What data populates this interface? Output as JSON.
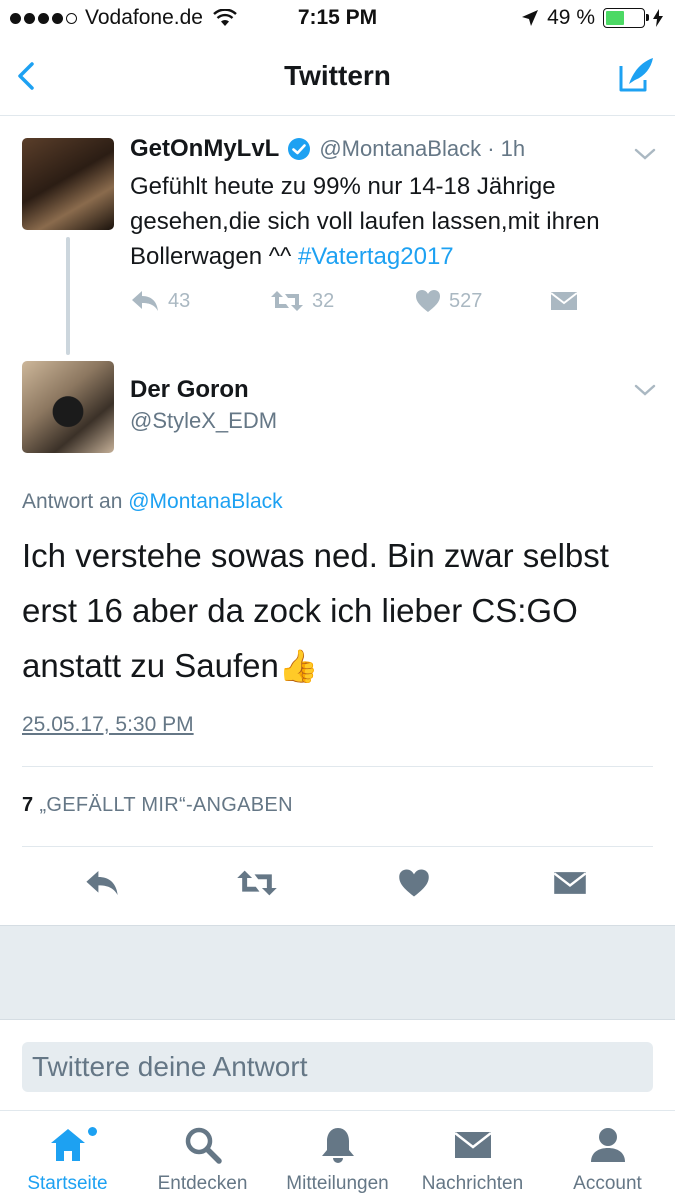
{
  "status_bar": {
    "carrier": "Vodafone.de",
    "time": "7:15 PM",
    "battery_percent": "49 %",
    "battery_level": 0.49
  },
  "nav": {
    "title": "Twittern",
    "back_icon": "chevron-left-icon",
    "compose_icon": "compose-tweet-icon"
  },
  "parent_tweet": {
    "name": "GetOnMyLvL",
    "verified": true,
    "handle_time": "@MontanaBlack · 1h",
    "text": "Gefühlt heute zu 99% nur 14-18 Jährige gesehen,die sich voll laufen lassen,mit ihren Bollerwagen ^^ ",
    "hashtag": "#Vatertag2017",
    "replies": "43",
    "retweets": "32",
    "likes": "527"
  },
  "reply_tweet": {
    "name": "Der Goron",
    "handle": "@StyleX_EDM",
    "reply_prefix": "Antwort an ",
    "reply_mention": "@MontanaBlack",
    "text": "Ich verstehe sowas ned. Bin zwar selbst erst 16 aber da zock ich lieber CS:GO anstatt zu Saufen",
    "emoji": "👍",
    "timestamp": "25.05.17, 5:30 PM",
    "likes_count": "7",
    "likes_label": "„GEFÄLLT MIR“-ANGABEN"
  },
  "reply_box": {
    "placeholder": "Twittere deine Antwort"
  },
  "tabbar": {
    "items": [
      {
        "label": "Startseite",
        "icon": "home-icon",
        "active": true
      },
      {
        "label": "Entdecken",
        "icon": "search-icon",
        "active": false
      },
      {
        "label": "Mitteilungen",
        "icon": "bell-icon",
        "active": false
      },
      {
        "label": "Nachrichten",
        "icon": "envelope-icon",
        "active": false
      },
      {
        "label": "Account",
        "icon": "person-icon",
        "active": false
      }
    ]
  },
  "colors": {
    "accent": "#1da1f2",
    "secondary_text": "#657786",
    "icon_gray": "#aab8c2",
    "band": "#e6ecf0"
  }
}
